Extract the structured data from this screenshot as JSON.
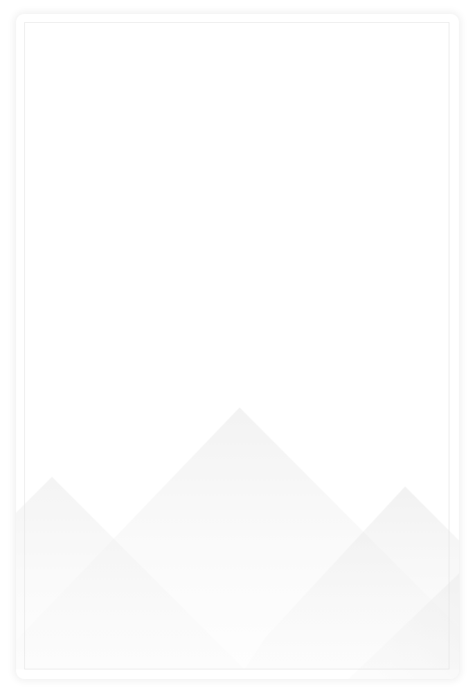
{
  "card": {
    "background_color": "#ffffff",
    "frame_color": "#e6e6e6",
    "decoration": "mountain-silhouettes",
    "mountain_color": "#e9e9e9"
  }
}
